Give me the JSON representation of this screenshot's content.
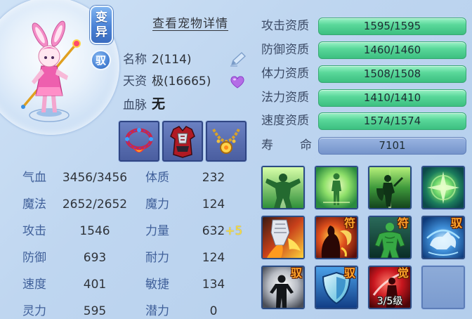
{
  "portrait": {
    "mutation_badge": "变异",
    "ride_badge": "驭",
    "pet_icon": "pink-rabbit-pet"
  },
  "detail_link": "查看宠物详情",
  "info": {
    "name_label": "名称",
    "name_value": "2(114)",
    "talent_label": "天资",
    "talent_value": "极(16665)",
    "bloodline_label": "血脉",
    "bloodline_value": "无",
    "rename_icon": "pencil-icon",
    "favorite_icon": "heart-icon"
  },
  "equipment": [
    {
      "icon": "red-necklace-icon"
    },
    {
      "icon": "red-armor-icon"
    },
    {
      "icon": "gold-necklace-icon"
    }
  ],
  "stats": [
    {
      "label": "气血",
      "value": "3456/3456",
      "label2": "体质",
      "value2": "232"
    },
    {
      "label": "魔法",
      "value": "2652/2652",
      "label2": "魔力",
      "value2": "124"
    },
    {
      "label": "攻击",
      "value": "1546",
      "label2": "力量",
      "value2": "632",
      "bonus2": "+5"
    },
    {
      "label": "防御",
      "value": "693",
      "label2": "耐力",
      "value2": "124"
    },
    {
      "label": "速度",
      "value": "401",
      "label2": "敏捷",
      "value2": "134"
    },
    {
      "label": "灵力",
      "value": "595",
      "label2": "潜力",
      "value2": "0"
    }
  ],
  "aptitudes": [
    {
      "label": "攻击资质",
      "value": "1595/1595"
    },
    {
      "label": "防御资质",
      "value": "1460/1460"
    },
    {
      "label": "体力资质",
      "value": "1508/1508"
    },
    {
      "label": "法力资质",
      "value": "1410/1410"
    },
    {
      "label": "速度资质",
      "value": "1574/1574"
    }
  ],
  "lifespan": {
    "label": "寿 命",
    "value": "7101"
  },
  "skills": [
    {
      "icon": "green-spread-arms-icon"
    },
    {
      "icon": "green-glow-figure-icon"
    },
    {
      "icon": "green-warrior-icon"
    },
    {
      "icon": "green-orb-icon"
    },
    {
      "icon": "flaming-fist-icon"
    },
    {
      "icon": "shadow-flame-figure-icon",
      "badge": "符"
    },
    {
      "icon": "green-muscle-figure-icon",
      "badge": "符"
    },
    {
      "icon": "blue-beast-icon",
      "badge": "驭"
    },
    {
      "icon": "dark-silhouette-icon",
      "badge": "驭"
    },
    {
      "icon": "blue-shield-icon",
      "badge": "驭"
    },
    {
      "icon": "red-figure-icon",
      "badge": "觉",
      "level": "3/5级"
    },
    {
      "icon": "empty-slot",
      "empty": true
    }
  ],
  "colors": {
    "background": "#bfd6f0",
    "aptitude_bar": "#4fd495",
    "lifespan_bar": "#7d9bd0",
    "bonus_text": "#ffe23a",
    "skill_badge": "#ffa52b"
  }
}
